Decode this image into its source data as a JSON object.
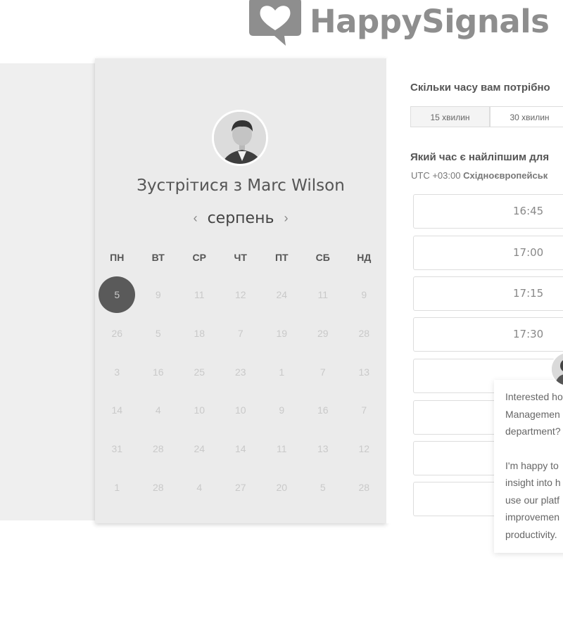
{
  "logo": {
    "text": "HappySignals"
  },
  "scheduler": {
    "title": "Зустрітися з Marc Wilson",
    "month": "серпень",
    "prev_icon": "chevron-left-icon",
    "next_icon": "chevron-right-icon",
    "weekdays": [
      "ПН",
      "ВТ",
      "СР",
      "ЧТ",
      "ПТ",
      "СБ",
      "НД"
    ],
    "weeks": [
      [
        "5",
        "9",
        "11",
        "12",
        "24",
        "11",
        "9"
      ],
      [
        "26",
        "5",
        "18",
        "7",
        "19",
        "29",
        "28"
      ],
      [
        "3",
        "16",
        "25",
        "23",
        "1",
        "7",
        "13"
      ],
      [
        "14",
        "4",
        "10",
        "10",
        "9",
        "16",
        "7"
      ],
      [
        "31",
        "28",
        "24",
        "14",
        "11",
        "13",
        "12"
      ],
      [
        "1",
        "28",
        "4",
        "27",
        "20",
        "5",
        "28"
      ]
    ],
    "selected_day": "5",
    "available_days": [
      "11",
      "26"
    ]
  },
  "duration": {
    "question": "Скільки часу вам потрібно",
    "options": [
      "15 хвилин",
      "30 хвилин"
    ],
    "selected": "15 хвилин"
  },
  "time": {
    "question": "Який час є найліпшим для",
    "timezone_offset": "UTC +03:00",
    "timezone_name": "Східноєвропейськ",
    "slots": [
      "16:45",
      "17:00",
      "17:15",
      "17:30",
      "",
      "",
      "",
      ""
    ]
  },
  "chat": {
    "message_1": "Interested ho\nManagemen\ndepartment?",
    "message_2": "I'm happy to\ninsight into h\nuse our platf\nimprovemen\nproductivity."
  },
  "colors": {
    "panel_bg": "#ebebeb",
    "selected_day_bg": "#5a5a5a",
    "logo": "#8e8e8e"
  }
}
